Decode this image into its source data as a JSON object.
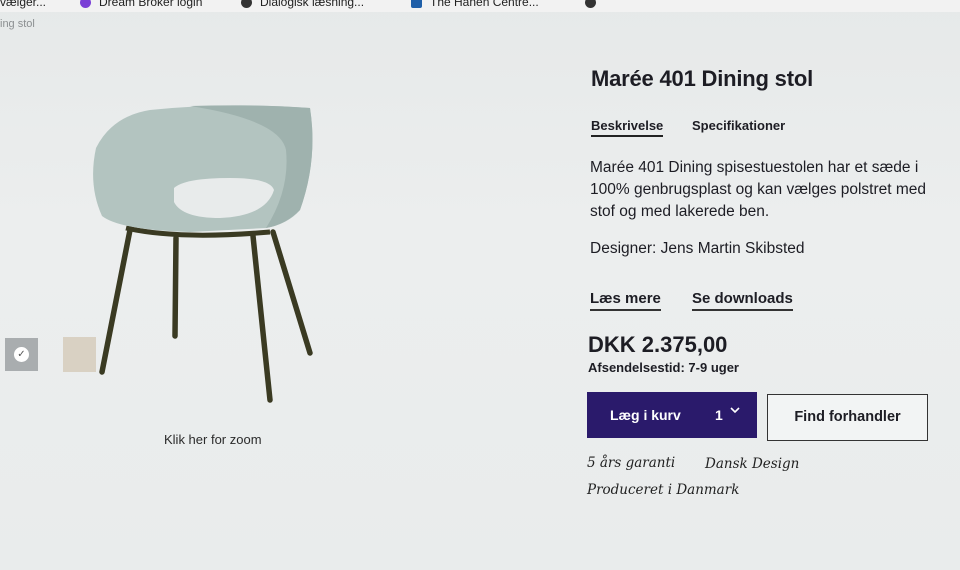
{
  "bookmarks": [
    {
      "label": "vælger..."
    },
    {
      "label": "Dream Broker login"
    },
    {
      "label": "Dialogisk læsning..."
    },
    {
      "label": "The Hanen Centre..."
    }
  ],
  "breadcrumb": "ing stol",
  "gallery": {
    "zoom_text": "Klik her for zoom",
    "thumb_check": "✓"
  },
  "product": {
    "title": "Marée 401 Dining stol",
    "tabs": [
      {
        "label": "Beskrivelse",
        "active": true
      },
      {
        "label": "Specifikationer",
        "active": false
      }
    ],
    "description": "Marée 401 Dining spisestuestolen har et sæde i 100% genbrugsplast og kan vælges polstret med stof og med lakerede ben.",
    "designer": "Designer: Jens Martin Skibsted",
    "read_more": "Læs mere",
    "downloads": "Se downloads",
    "price": "DKK 2.375,00",
    "shipping": "Afsendelsestid: 7-9 uger",
    "cart_label": "Læg i kurv",
    "quantity": "1",
    "dealer_label": "Find forhandler",
    "features": [
      "5 års garanti",
      "Dansk Design",
      "Produceret i Danmark"
    ]
  },
  "colors": {
    "cart_bg": "#2a1a6b",
    "chair_shell": "#b3c4c0",
    "chair_legs": "#3a3a22",
    "thumb_grey": "#a9adaf",
    "thumb_beige": "#d9d1c3"
  }
}
